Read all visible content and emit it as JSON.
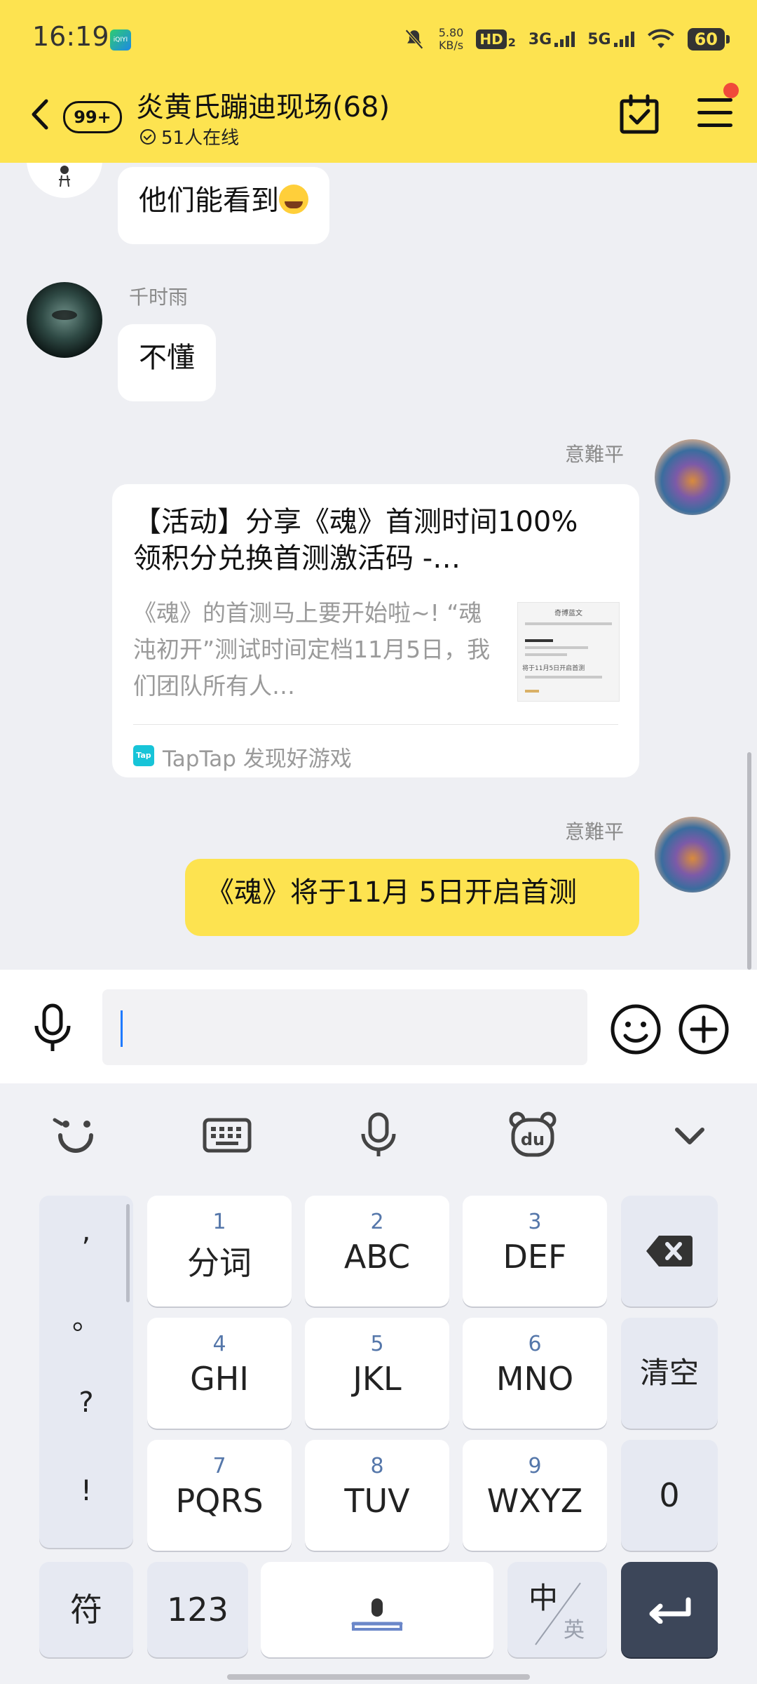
{
  "status_bar": {
    "time": "16:19",
    "app_icon_text": "iQIYI",
    "net_speed_value": "5.80",
    "net_speed_unit": "KB/s",
    "hd_label": "HD",
    "hd_sub": "2",
    "signal_3g": "3G",
    "signal_5g": "5G",
    "battery": "60"
  },
  "header": {
    "unread_count": "99+",
    "group_title": "炎黄氏蹦迪现场(68)",
    "online_text": "51人在线"
  },
  "messages": [
    {
      "sender": "",
      "text": "他们能看到"
    },
    {
      "sender": "千时雨",
      "text": "不懂"
    },
    {
      "sender": "意難平",
      "card": {
        "title": "【活动】分享《魂》首测时间100%领积分兑换首测激活码 -…",
        "description": "《魂》的首测马上要开始啦~! “魂沌初开”测试时间定档11月5日，我们团队所有人…",
        "thumb_title": "奇博蓝文",
        "thumb_caption": "将于11月5日开启首测",
        "logo_text": "Tap",
        "source": "TapTap 发现好游戏"
      }
    },
    {
      "sender": "意難平",
      "text": "《魂》将于11月 5日开启首测"
    }
  ],
  "input": {
    "value": "",
    "placeholder": ""
  },
  "keyboard": {
    "punctuation": [
      ",",
      "。",
      "?",
      "!"
    ],
    "keys": [
      {
        "num": "1",
        "label": "分词"
      },
      {
        "num": "2",
        "label": "ABC"
      },
      {
        "num": "3",
        "label": "DEF"
      },
      {
        "num": "4",
        "label": "GHI"
      },
      {
        "num": "5",
        "label": "JKL"
      },
      {
        "num": "6",
        "label": "MNO"
      },
      {
        "num": "7",
        "label": "PQRS"
      },
      {
        "num": "8",
        "label": "TUV"
      },
      {
        "num": "9",
        "label": "WXYZ"
      }
    ],
    "clear": "清空",
    "zero": "0",
    "symbol": "符",
    "numeric": "123",
    "lang_main": "中",
    "lang_alt": "英"
  }
}
